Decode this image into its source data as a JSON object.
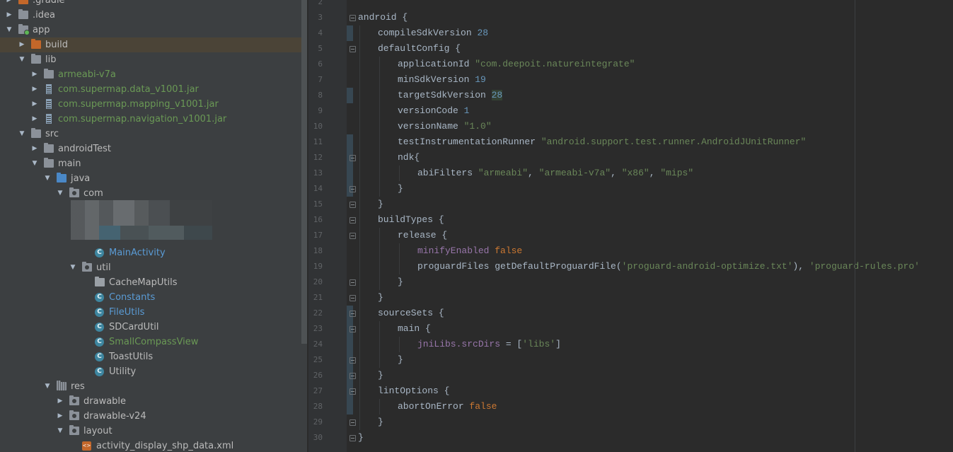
{
  "project_tree": {
    "items": [
      {
        "label": ".gradle",
        "icon": "folder-orange-icon",
        "arrow": "right",
        "indent": 0,
        "color": "default"
      },
      {
        "label": ".idea",
        "icon": "folder-icon",
        "arrow": "right",
        "indent": 0,
        "color": "default"
      },
      {
        "label": "app",
        "icon": "module-folder-icon",
        "arrow": "down",
        "indent": 0,
        "color": "default"
      },
      {
        "label": "build",
        "icon": "folder-orange-icon",
        "arrow": "right",
        "indent": 1,
        "color": "default",
        "selected": true
      },
      {
        "label": "lib",
        "icon": "folder-icon",
        "arrow": "down",
        "indent": 1,
        "color": "default"
      },
      {
        "label": "armeabi-v7a",
        "icon": "folder-icon",
        "arrow": "right",
        "indent": 2,
        "color": "green"
      },
      {
        "label": "com.supermap.data_v1001.jar",
        "icon": "jar-icon",
        "arrow": "right",
        "indent": 2,
        "color": "green"
      },
      {
        "label": "com.supermap.mapping_v1001.jar",
        "icon": "jar-icon",
        "arrow": "right",
        "indent": 2,
        "color": "green"
      },
      {
        "label": "com.supermap.navigation_v1001.jar",
        "icon": "jar-icon",
        "arrow": "right",
        "indent": 2,
        "color": "green"
      },
      {
        "label": "src",
        "icon": "folder-icon",
        "arrow": "down",
        "indent": 1,
        "color": "default"
      },
      {
        "label": "androidTest",
        "icon": "folder-icon",
        "arrow": "right",
        "indent": 2,
        "color": "default"
      },
      {
        "label": "main",
        "icon": "folder-icon",
        "arrow": "down",
        "indent": 2,
        "color": "default"
      },
      {
        "label": "java",
        "icon": "folder-blue-icon",
        "arrow": "down",
        "indent": 3,
        "color": "default"
      },
      {
        "label": "com",
        "icon": "package-icon",
        "arrow": "down",
        "indent": 4,
        "color": "default"
      },
      {
        "label": "",
        "icon": "",
        "arrow": "",
        "indent": 5,
        "color": "default",
        "blurred": true
      },
      {
        "label": "",
        "icon": "",
        "arrow": "",
        "indent": 5,
        "color": "default",
        "blurred": true
      },
      {
        "label": "",
        "icon": "",
        "arrow": "",
        "indent": 5,
        "color": "default",
        "blurred": true
      },
      {
        "label": "MainActivity",
        "icon": "class-icon",
        "arrow": "",
        "indent": 6,
        "color": "blue"
      },
      {
        "label": "util",
        "icon": "package-icon",
        "arrow": "down",
        "indent": 5,
        "color": "default"
      },
      {
        "label": "CacheMapUtils",
        "icon": "file-icon",
        "arrow": "",
        "indent": 6,
        "color": "default"
      },
      {
        "label": "Constants",
        "icon": "class-icon",
        "arrow": "",
        "indent": 6,
        "color": "blue"
      },
      {
        "label": "FileUtils",
        "icon": "class-icon",
        "arrow": "",
        "indent": 6,
        "color": "blue"
      },
      {
        "label": "SDCardUtil",
        "icon": "class-icon",
        "arrow": "",
        "indent": 6,
        "color": "default"
      },
      {
        "label": "SmallCompassView",
        "icon": "class-icon",
        "arrow": "",
        "indent": 6,
        "color": "green"
      },
      {
        "label": "ToastUtils",
        "icon": "class-icon",
        "arrow": "",
        "indent": 6,
        "color": "default"
      },
      {
        "label": "Utility",
        "icon": "class-icon",
        "arrow": "",
        "indent": 6,
        "color": "default"
      },
      {
        "label": "res",
        "icon": "res-folder-icon",
        "arrow": "down",
        "indent": 3,
        "color": "default"
      },
      {
        "label": "drawable",
        "icon": "package-icon",
        "arrow": "right",
        "indent": 4,
        "color": "default"
      },
      {
        "label": "drawable-v24",
        "icon": "package-icon",
        "arrow": "right",
        "indent": 4,
        "color": "default"
      },
      {
        "label": "layout",
        "icon": "package-icon",
        "arrow": "down",
        "indent": 4,
        "color": "default"
      },
      {
        "label": "activity_display_shp_data.xml",
        "icon": "xml-icon",
        "arrow": "",
        "indent": 5,
        "color": "default"
      }
    ]
  },
  "editor": {
    "first_line_number": 2,
    "lines": [
      {
        "indent": 0,
        "tokens": []
      },
      {
        "indent": 0,
        "fold": true,
        "tokens": [
          {
            "t": "android {",
            "c": ""
          }
        ]
      },
      {
        "indent": 1,
        "marker": true,
        "tokens": [
          {
            "t": "compileSdkVersion ",
            "c": ""
          },
          {
            "t": "28",
            "c": "n"
          }
        ]
      },
      {
        "indent": 1,
        "fold": true,
        "tokens": [
          {
            "t": "defaultConfig {",
            "c": ""
          }
        ]
      },
      {
        "indent": 2,
        "tokens": [
          {
            "t": "applicationId ",
            "c": ""
          },
          {
            "t": "\"com.deepoit.natureintegrate\"",
            "c": "s"
          }
        ]
      },
      {
        "indent": 2,
        "tokens": [
          {
            "t": "minSdkVersion ",
            "c": ""
          },
          {
            "t": "19",
            "c": "n"
          }
        ]
      },
      {
        "indent": 2,
        "marker": true,
        "tokens": [
          {
            "t": "targetSdkVersion ",
            "c": ""
          },
          {
            "t": "28",
            "c": "n hl"
          }
        ]
      },
      {
        "indent": 2,
        "tokens": [
          {
            "t": "versionCode ",
            "c": ""
          },
          {
            "t": "1",
            "c": "n"
          }
        ]
      },
      {
        "indent": 2,
        "tokens": [
          {
            "t": "versionName ",
            "c": ""
          },
          {
            "t": "\"1.0\"",
            "c": "s"
          }
        ]
      },
      {
        "indent": 2,
        "marker": true,
        "tokens": [
          {
            "t": "testInstrumentationRunner ",
            "c": ""
          },
          {
            "t": "\"android.support.test.runner.AndroidJUnitRunner\"",
            "c": "s"
          }
        ]
      },
      {
        "indent": 2,
        "marker": true,
        "fold": true,
        "tokens": [
          {
            "t": "ndk{",
            "c": ""
          }
        ]
      },
      {
        "indent": 3,
        "marker": true,
        "tokens": [
          {
            "t": "abiFilters ",
            "c": ""
          },
          {
            "t": "\"armeabi\"",
            "c": "s"
          },
          {
            "t": ", ",
            "c": ""
          },
          {
            "t": "\"armeabi-v7a\"",
            "c": "s"
          },
          {
            "t": ", ",
            "c": ""
          },
          {
            "t": "\"x86\"",
            "c": "s"
          },
          {
            "t": ", ",
            "c": ""
          },
          {
            "t": "\"mips\"",
            "c": "s"
          }
        ]
      },
      {
        "indent": 2,
        "marker": true,
        "fold": true,
        "tokens": [
          {
            "t": "}",
            "c": ""
          }
        ]
      },
      {
        "indent": 1,
        "fold": true,
        "tokens": [
          {
            "t": "}",
            "c": ""
          }
        ]
      },
      {
        "indent": 1,
        "fold": true,
        "tokens": [
          {
            "t": "buildTypes {",
            "c": ""
          }
        ]
      },
      {
        "indent": 2,
        "fold": true,
        "tokens": [
          {
            "t": "release {",
            "c": ""
          }
        ]
      },
      {
        "indent": 3,
        "tokens": [
          {
            "t": "minifyEnabled ",
            "c": "p"
          },
          {
            "t": "false",
            "c": "k"
          }
        ]
      },
      {
        "indent": 3,
        "tokens": [
          {
            "t": "proguardFiles getDefaultProguardFile(",
            "c": ""
          },
          {
            "t": "'proguard-android-optimize.txt'",
            "c": "s"
          },
          {
            "t": "), ",
            "c": ""
          },
          {
            "t": "'proguard-rules.pro'",
            "c": "s"
          }
        ]
      },
      {
        "indent": 2,
        "fold": true,
        "tokens": [
          {
            "t": "}",
            "c": ""
          }
        ]
      },
      {
        "indent": 1,
        "fold": true,
        "tokens": [
          {
            "t": "}",
            "c": ""
          }
        ]
      },
      {
        "indent": 1,
        "marker": true,
        "fold": true,
        "tokens": [
          {
            "t": "sourceSets {",
            "c": ""
          }
        ]
      },
      {
        "indent": 2,
        "marker": true,
        "fold": true,
        "tokens": [
          {
            "t": "main {",
            "c": ""
          }
        ]
      },
      {
        "indent": 3,
        "marker": true,
        "tokens": [
          {
            "t": "jniLibs.",
            "c": "p"
          },
          {
            "t": "srcDirs",
            "c": "p"
          },
          {
            "t": " = [",
            "c": ""
          },
          {
            "t": "'libs'",
            "c": "s"
          },
          {
            "t": "]",
            "c": ""
          }
        ]
      },
      {
        "indent": 2,
        "marker": true,
        "fold": true,
        "tokens": [
          {
            "t": "}",
            "c": ""
          }
        ]
      },
      {
        "indent": 1,
        "marker": true,
        "fold": true,
        "tokens": [
          {
            "t": "}",
            "c": ""
          }
        ]
      },
      {
        "indent": 1,
        "marker": true,
        "fold": true,
        "tokens": [
          {
            "t": "lintOptions {",
            "c": ""
          }
        ]
      },
      {
        "indent": 2,
        "marker": true,
        "tokens": [
          {
            "t": "abortOnError ",
            "c": ""
          },
          {
            "t": "false",
            "c": "k"
          }
        ]
      },
      {
        "indent": 1,
        "fold": true,
        "tokens": [
          {
            "t": "}",
            "c": ""
          }
        ]
      },
      {
        "indent": 0,
        "fold": true,
        "tokens": [
          {
            "t": "}",
            "c": ""
          }
        ]
      }
    ]
  },
  "colors": {
    "tree_bg": "#3c3f41",
    "editor_bg": "#2b2b2b",
    "gutter_bg": "#313335",
    "keyword": "#cc7832",
    "string": "#6a8759",
    "number": "#6897bb",
    "property": "#9876aa"
  }
}
